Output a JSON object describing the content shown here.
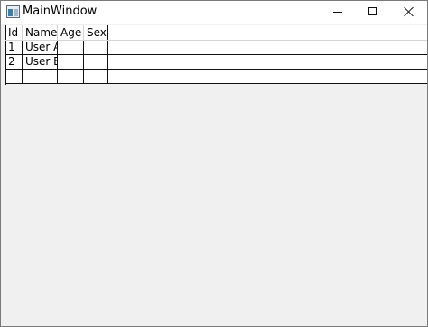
{
  "window": {
    "title": "MainWindow",
    "icon": "app-window-icon"
  },
  "caption_buttons": {
    "minimize": "minimize-icon",
    "maximize": "maximize-icon",
    "close": "close-icon"
  },
  "grid": {
    "columns": [
      "Id",
      "Name",
      "Age",
      "Sex"
    ],
    "rows": [
      [
        "1",
        "User A",
        "",
        ""
      ],
      [
        "2",
        "User B",
        "",
        ""
      ],
      [
        "",
        "",
        "",
        ""
      ]
    ]
  }
}
